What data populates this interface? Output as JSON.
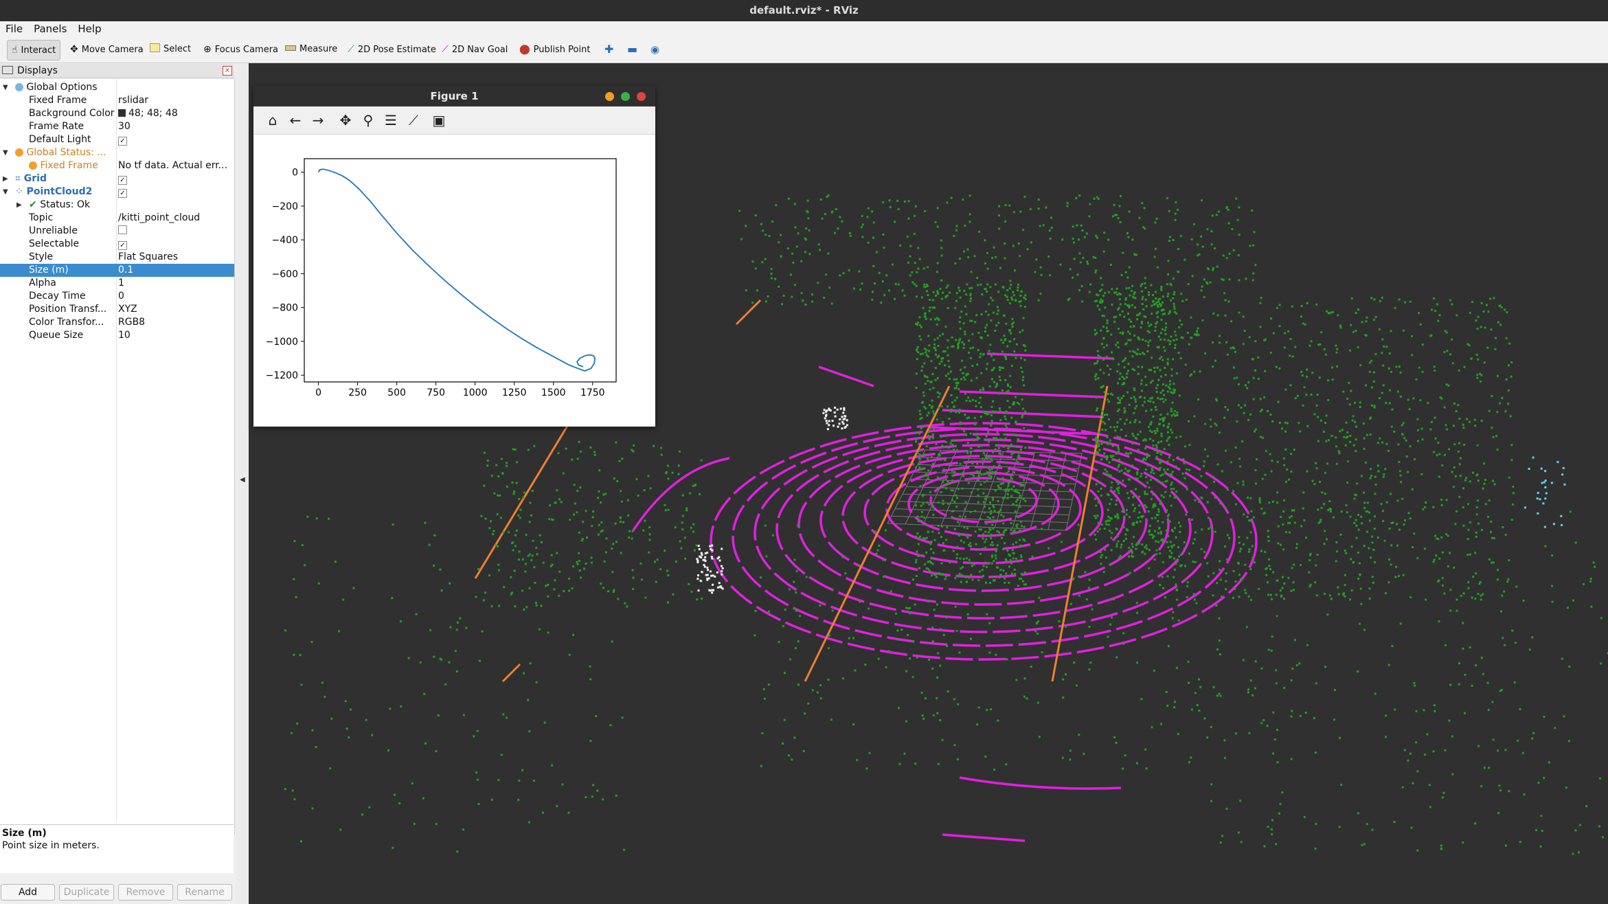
{
  "window": {
    "title": "default.rviz* - RViz"
  },
  "menu": [
    "File",
    "Panels",
    "Help"
  ],
  "toolbar": {
    "interact": "Interact",
    "move_camera": "Move Camera",
    "select": "Select",
    "focus_camera": "Focus Camera",
    "measure": "Measure",
    "pose_estimate": "2D Pose Estimate",
    "nav_goal": "2D Nav Goal",
    "publish_point": "Publish Point"
  },
  "displays": {
    "title": "Displays",
    "rows": [
      {
        "label": "Global Options",
        "value": ""
      },
      {
        "label": "Fixed Frame",
        "value": "rslidar"
      },
      {
        "label": "Background Color",
        "value": "48; 48; 48"
      },
      {
        "label": "Frame Rate",
        "value": "30"
      },
      {
        "label": "Default Light",
        "value": "✓"
      },
      {
        "label": "Global Status: ...",
        "value": ""
      },
      {
        "label": "Fixed Frame",
        "value": "No tf data.  Actual err..."
      },
      {
        "label": "Grid",
        "value": "✓"
      },
      {
        "label": "PointCloud2",
        "value": "✓"
      },
      {
        "label": "Status: Ok",
        "value": ""
      },
      {
        "label": "Topic",
        "value": "/kitti_point_cloud"
      },
      {
        "label": "Unreliable",
        "value": ""
      },
      {
        "label": "Selectable",
        "value": "✓"
      },
      {
        "label": "Style",
        "value": "Flat Squares"
      },
      {
        "label": "Size (m)",
        "value": "0.1"
      },
      {
        "label": "Alpha",
        "value": "1"
      },
      {
        "label": "Decay Time",
        "value": "0"
      },
      {
        "label": "Position Transf...",
        "value": "XYZ"
      },
      {
        "label": "Color Transfor...",
        "value": "RGB8"
      },
      {
        "label": "Queue Size",
        "value": "10"
      }
    ]
  },
  "description": {
    "title": "Size (m)",
    "text": "Point size in meters."
  },
  "buttons": {
    "add": "Add",
    "duplicate": "Duplicate",
    "remove": "Remove",
    "rename": "Rename"
  },
  "figure": {
    "title": "Figure 1"
  },
  "chart_data": {
    "type": "line",
    "x": [
      0,
      10,
      30,
      60,
      100,
      150,
      200,
      260,
      330,
      400,
      500,
      600,
      700,
      800,
      900,
      1000,
      1100,
      1200,
      1300,
      1400,
      1500,
      1600,
      1650,
      1700,
      1740,
      1760,
      1765,
      1755,
      1730,
      1700,
      1670,
      1650,
      1660,
      1690
    ],
    "y": [
      0,
      15,
      18,
      12,
      0,
      -20,
      -50,
      -100,
      -170,
      -250,
      -360,
      -460,
      -550,
      -635,
      -715,
      -790,
      -860,
      -925,
      -985,
      -1040,
      -1090,
      -1140,
      -1158,
      -1175,
      -1160,
      -1130,
      -1100,
      -1085,
      -1080,
      -1085,
      -1100,
      -1120,
      -1140,
      -1150
    ],
    "xticks": [
      0,
      250,
      500,
      750,
      1000,
      1250,
      1500,
      1750
    ],
    "yticks": [
      0,
      -200,
      -400,
      -600,
      -800,
      -1000,
      -1200
    ],
    "xlim": [
      -90,
      1900
    ],
    "ylim": [
      -1240,
      80
    ],
    "color": "#1f77b4"
  },
  "colors": {
    "viewport_bg": "#303030",
    "selection": "#3b8bcf",
    "ground": "#e020e0",
    "vegetation": "#22a022",
    "curb": "#f07f30"
  }
}
